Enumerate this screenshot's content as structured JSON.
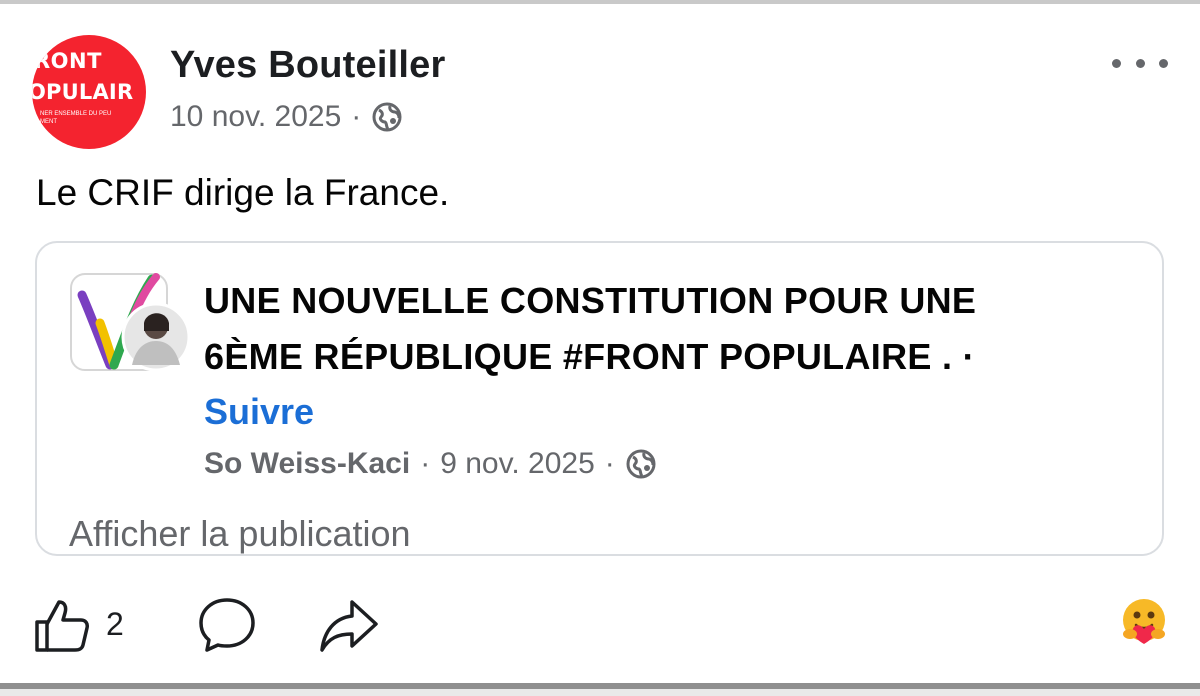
{
  "post": {
    "author_name": "Yves Bouteiller",
    "date": "10 nov. 2025",
    "separator": "·",
    "audience_icon": "globe-icon",
    "text": "Le CRIF dirige la France.",
    "avatar": {
      "line1": "RONT",
      "line2": "OPULAIR",
      "line3": "NER ENSEMBLE DU PEU",
      "line4": "MENT",
      "color": "#f4232f"
    }
  },
  "shared": {
    "title_line1": "UNE NOUVELLE CONSTITUTION POUR UNE",
    "title_line2": "6ÈME RÉPUBLIQUE  #FRONT POPULAIRE . ·",
    "follow_label": "Suivre",
    "author": "So Weiss-Kaci",
    "date": "9 nov. 2025",
    "separator": "·",
    "audience_icon": "globe-icon",
    "show_post_label": "Afficher la publication"
  },
  "actions": {
    "like_icon": "thumbs-up-icon",
    "like_count": "2",
    "comment_icon": "comment-icon",
    "share_icon": "share-icon",
    "reaction_icon": "care-emoji-icon"
  },
  "colors": {
    "link": "#1b6ed6",
    "secondary_text": "#65676b",
    "card_border": "#dadde1"
  }
}
